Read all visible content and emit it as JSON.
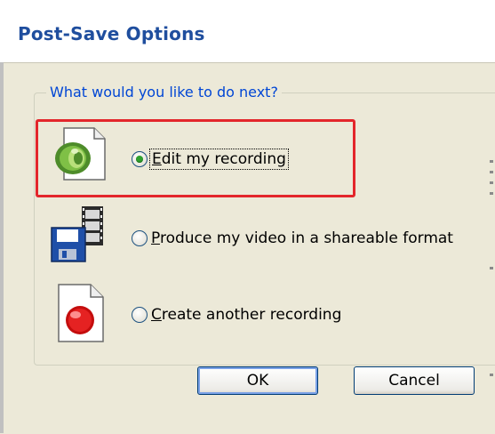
{
  "dialog": {
    "title": "Post-Save Options",
    "group_label": "What would you like to do next?",
    "options": [
      {
        "key": "E",
        "rest": "dit my recording",
        "checked": true,
        "icon": "edit-recording-icon"
      },
      {
        "key": "P",
        "rest": "roduce my video in a shareable format",
        "checked": false,
        "icon": "produce-video-icon"
      },
      {
        "key": "C",
        "rest": "reate another recording",
        "checked": false,
        "icon": "new-recording-icon"
      }
    ],
    "buttons": {
      "ok": "OK",
      "cancel": "Cancel"
    },
    "colors": {
      "title": "#1f4e9e",
      "group_label": "#0046d5",
      "highlight": "#e3262b",
      "radio_check": "#2fa12f",
      "dialog_bg": "#ece9d8"
    }
  }
}
